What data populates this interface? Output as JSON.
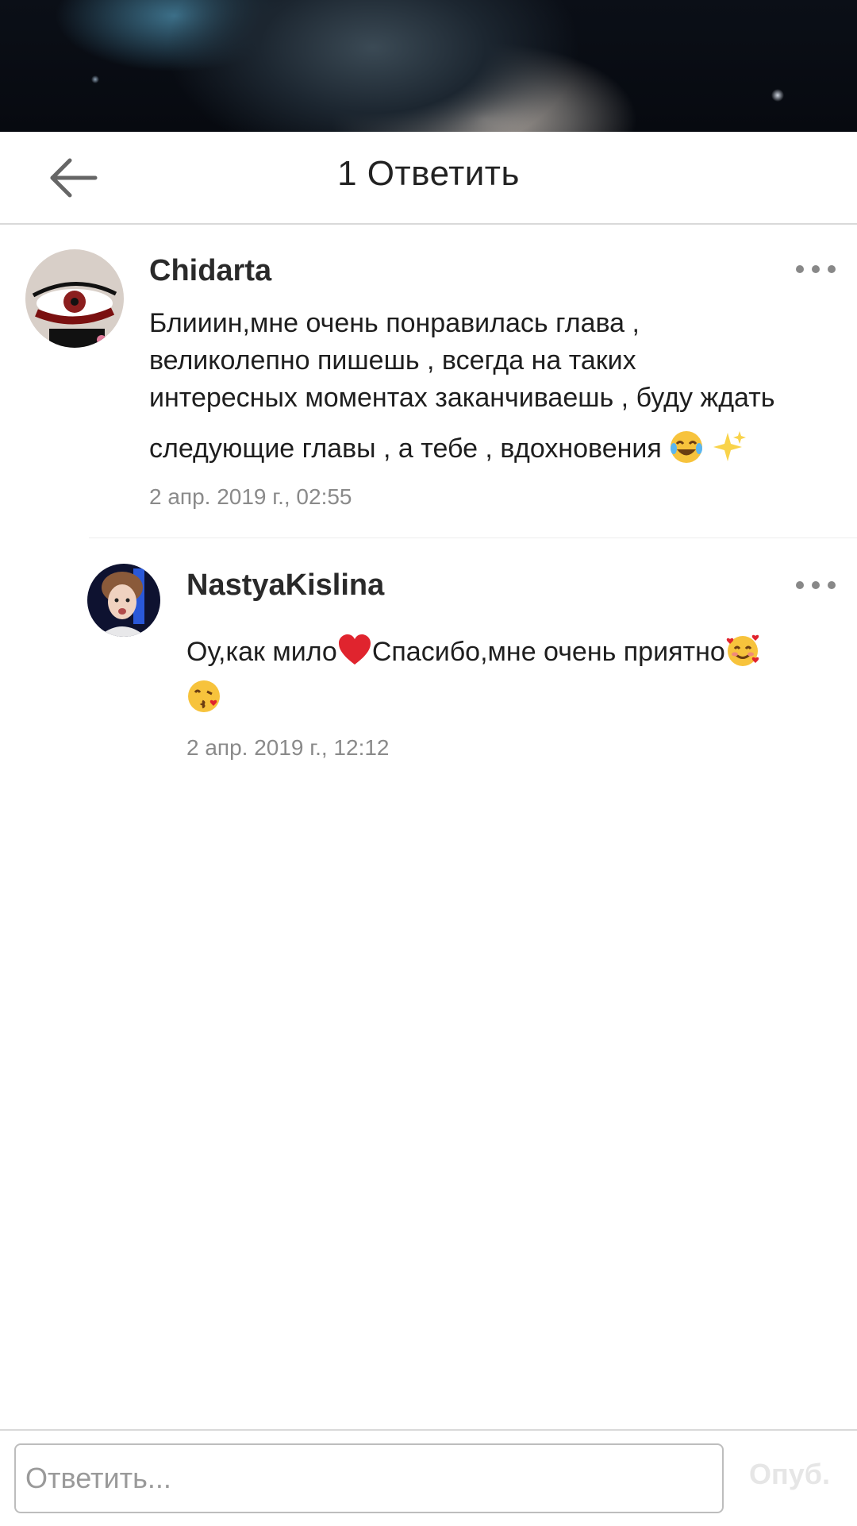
{
  "header": {
    "title": "1 Ответить"
  },
  "comments": [
    {
      "username": "Chidarta",
      "text_line1": "Блииин,мне очень понравилась глава ,",
      "text_line2": "великолепно пишешь , всегда на таких",
      "text_line3": "интересных моментах заканчиваешь , буду ждать",
      "text_line4": "следующие главы , а тебе , вдохновения",
      "emojis": [
        "face-with-tears-of-joy",
        "sparkles"
      ],
      "timestamp": "2 апр. 2019 г., 02:55"
    },
    {
      "username": "NastyaKislina",
      "text_part1": "Оу,как мило",
      "text_part2": "Спасибо,мне очень приятно",
      "emojis": [
        "red-heart",
        "smiling-face-with-hearts",
        "face-blowing-a-kiss"
      ],
      "timestamp": "2 апр. 2019 г., 12:12"
    }
  ],
  "reply_bar": {
    "placeholder": "Ответить...",
    "value": "",
    "publish_label": "Опуб."
  },
  "colors": {
    "text": "#222222",
    "timestamp": "#8a8a8a",
    "border": "#d9d9d9",
    "publish_disabled": "#e6e6e6"
  }
}
